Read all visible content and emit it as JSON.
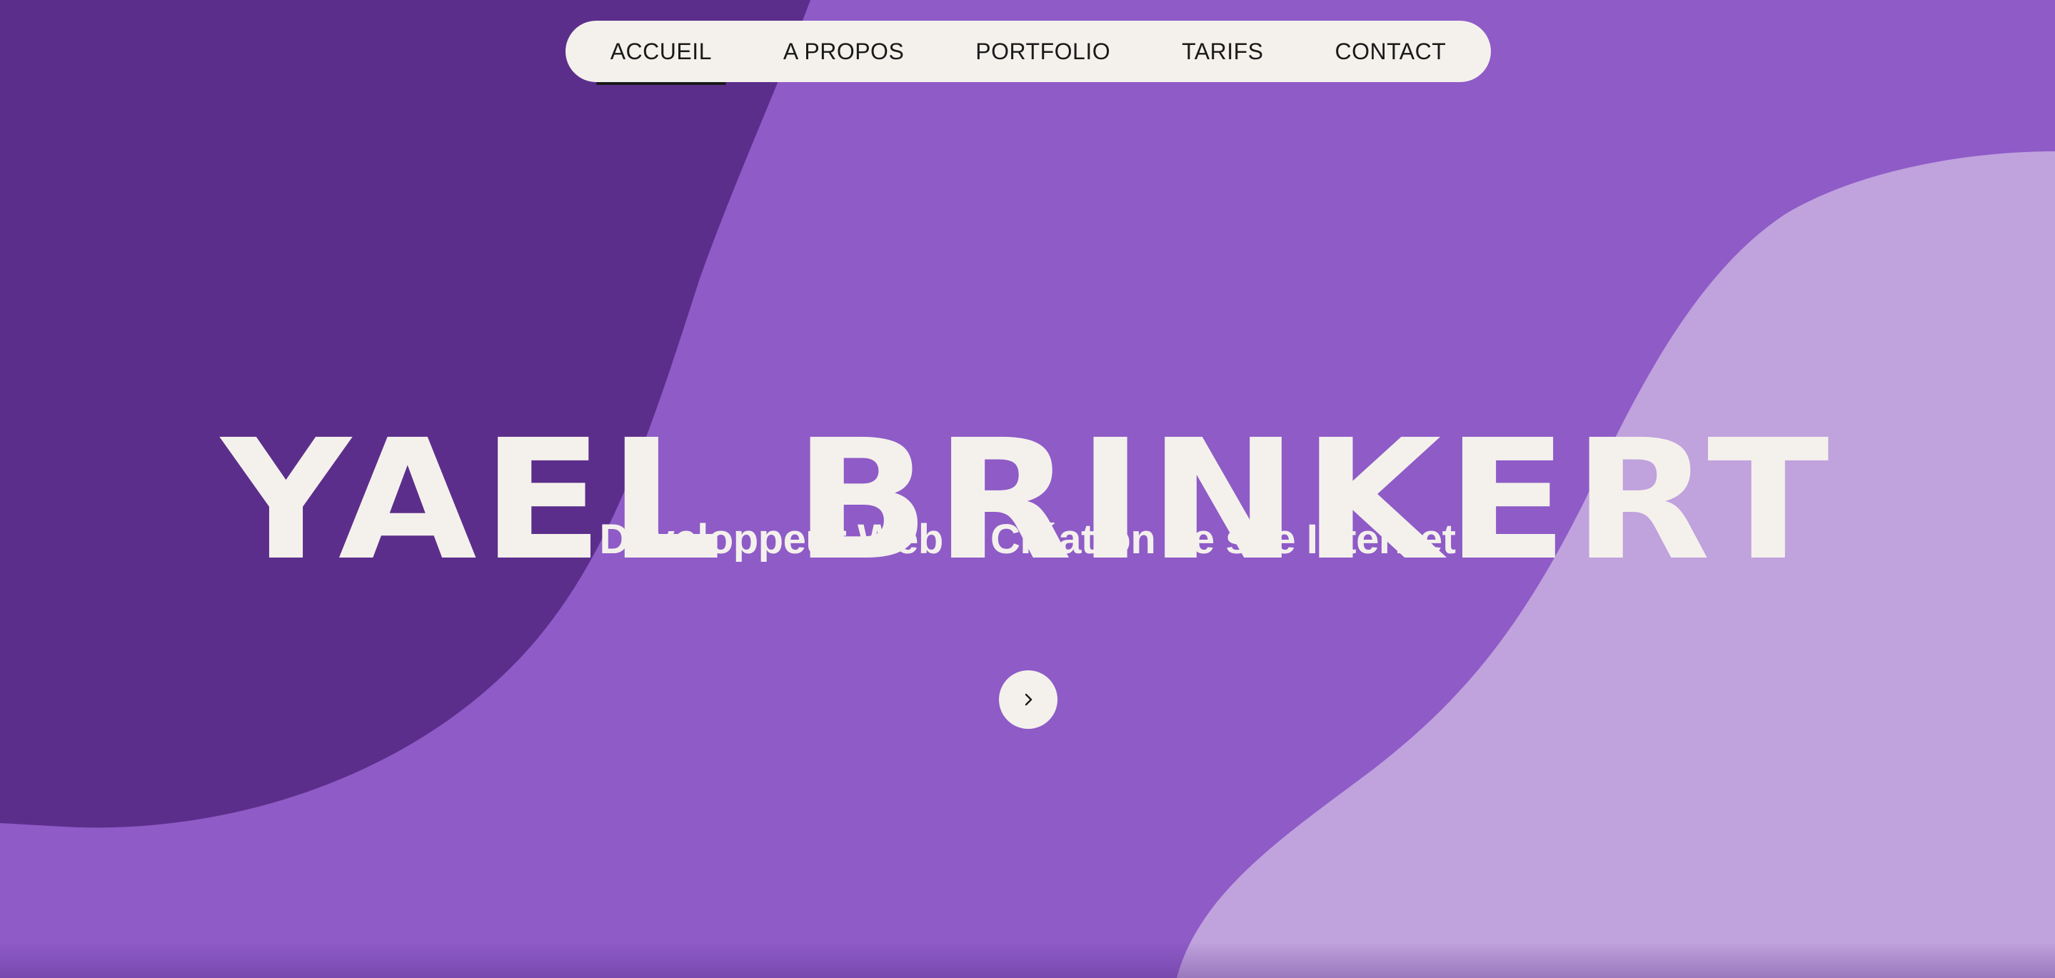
{
  "nav": {
    "items": [
      {
        "label": "ACCUEIL",
        "active": true
      },
      {
        "label": "A PROPOS",
        "active": false
      },
      {
        "label": "PORTFOLIO",
        "active": false
      },
      {
        "label": "TARIFS",
        "active": false
      },
      {
        "label": "CONTACT",
        "active": false
      }
    ]
  },
  "hero": {
    "name": "YAEL BRINKERT",
    "tagline_part1": "Développeur Web",
    "tagline_amp": "&",
    "tagline_part2": "Création de site Internet"
  },
  "scroll_button": {
    "icon": "chevron-right-icon"
  },
  "colors": {
    "background_mid": "#8e5bc7",
    "background_dark": "#5c2e8b",
    "background_light": "#c0a2dd",
    "text_light": "#f4f1ec",
    "text_dark": "#1a1a1a"
  }
}
